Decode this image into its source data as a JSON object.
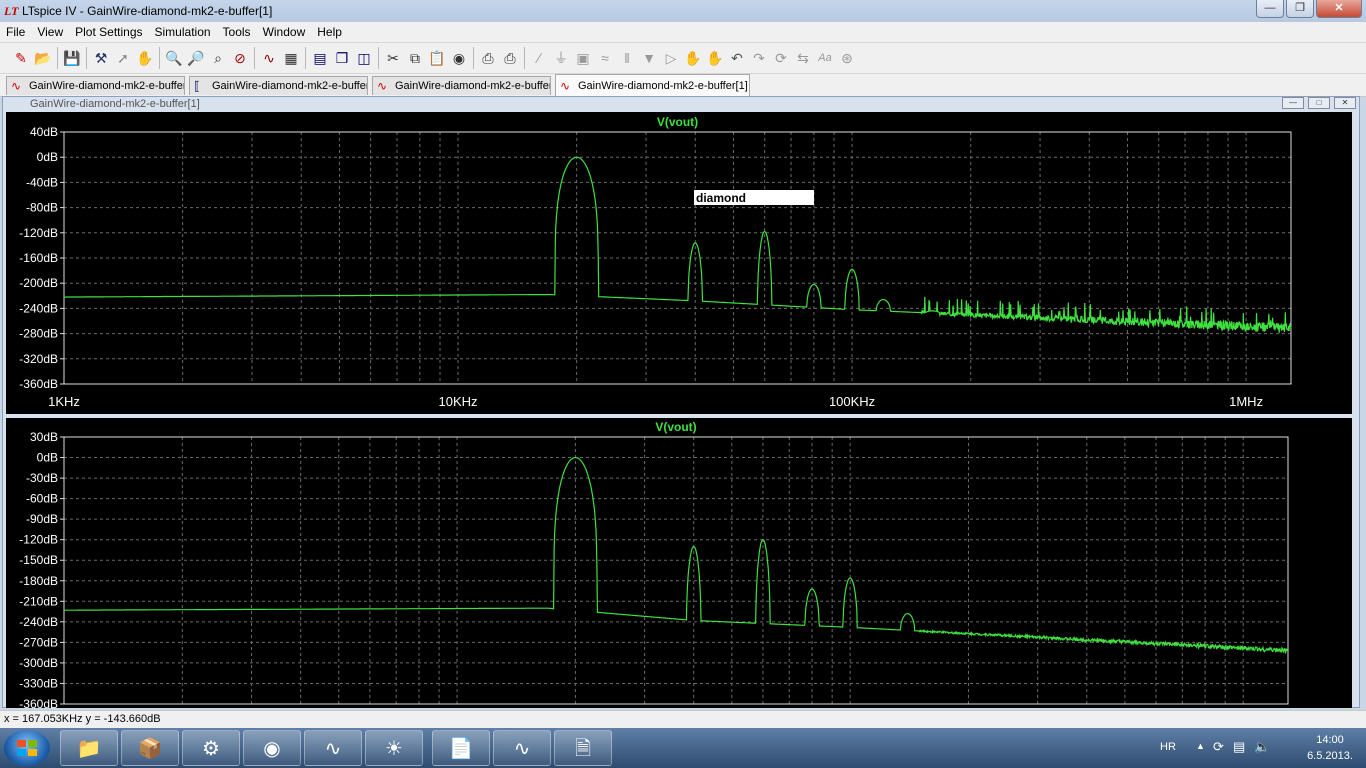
{
  "window": {
    "title": "LTspice IV - GainWire-diamond-mk2-e-buffer[1]",
    "app_icon": "LT"
  },
  "menu": [
    "File",
    "View",
    "Plot Settings",
    "Simulation",
    "Tools",
    "Window",
    "Help"
  ],
  "toolbar_icons": [
    "new-schematic-icon",
    "open-icon",
    "save-icon",
    "control-panel-icon",
    "run-icon",
    "halt-icon",
    "zoom-in-icon",
    "zoom-out-icon",
    "zoom-fit-icon",
    "zoom-cancel-icon",
    "autorange-icon",
    "mark-icon",
    "tile-horizontal-icon",
    "cascade-icon",
    "tile-vertical-icon",
    "cut-icon",
    "copy-icon",
    "paste-icon",
    "find-icon",
    "print-preview-icon",
    "print-icon",
    "wire-icon",
    "ground-icon",
    "label-icon",
    "resistor-icon",
    "capacitor-icon",
    "diode-icon",
    "component-icon",
    "move-icon",
    "drag-icon",
    "undo-icon",
    "redo-icon",
    "rotate-icon",
    "mirror-icon",
    "text-icon",
    "spice-directive-icon"
  ],
  "tabs": [
    {
      "label": "GainWire-diamond-mk2-e-buffer",
      "icon": "waveform-icon",
      "active": false
    },
    {
      "label": "GainWire-diamond-mk2-e-buffer",
      "icon": "schematic-icon",
      "active": false
    },
    {
      "label": "GainWire-diamond-mk2-e-buffer",
      "icon": "waveform-icon",
      "active": false
    },
    {
      "label": "GainWire-diamond-mk2-e-buffer[1]",
      "icon": "waveform-icon",
      "active": true
    }
  ],
  "mdi_child": {
    "title": "GainWire-diamond-mk2-e-buffer[1]"
  },
  "chart_data": [
    {
      "type": "line",
      "title": "V(vout)",
      "annotation": "diamond",
      "xscale": "log",
      "xlim": [
        1000,
        1300000
      ],
      "xticks": [
        "1KHz",
        "10KHz",
        "100KHz",
        "1MHz"
      ],
      "ylim": [
        -360,
        40
      ],
      "yticks": [
        "40dB",
        "0dB",
        "-40dB",
        "-80dB",
        "-120dB",
        "-160dB",
        "-200dB",
        "-240dB",
        "-280dB",
        "-320dB",
        "-360dB"
      ],
      "grid": true,
      "series": [
        {
          "name": "V(vout)",
          "color": "#3fe03f",
          "noise_floor": "rising",
          "peaks": [
            {
              "f": 20000,
              "db": 0
            },
            {
              "f": 40000,
              "db": -136
            },
            {
              "f": 60000,
              "db": -118
            },
            {
              "f": 80000,
              "db": -202
            },
            {
              "f": 100000,
              "db": -178
            },
            {
              "f": 120000,
              "db": -226
            },
            {
              "f": 160000,
              "db": -244
            }
          ],
          "floor_points": [
            [
              1000,
              -222
            ],
            [
              17000,
              -218
            ],
            [
              40000,
              -228
            ],
            [
              100000,
              -242
            ],
            [
              1300000,
              -272
            ]
          ]
        }
      ]
    },
    {
      "type": "line",
      "title": "V(vout)",
      "xscale": "log",
      "xlim": [
        1000,
        1300000
      ],
      "ylim": [
        -360,
        30
      ],
      "yticks": [
        "30dB",
        "0dB",
        "-30dB",
        "-60dB",
        "-90dB",
        "-120dB",
        "-150dB",
        "-180dB",
        "-210dB",
        "-240dB",
        "-270dB",
        "-300dB",
        "-330dB",
        "-360dB"
      ],
      "grid": true,
      "series": [
        {
          "name": "V(vout)",
          "color": "#3fe03f",
          "noise_floor": "falling",
          "peaks": [
            {
              "f": 20000,
              "db": 0
            },
            {
              "f": 40000,
              "db": -130
            },
            {
              "f": 60000,
              "db": -120
            },
            {
              "f": 80000,
              "db": -192
            },
            {
              "f": 100000,
              "db": -176
            },
            {
              "f": 140000,
              "db": -228
            }
          ],
          "floor_points": [
            [
              1000,
              -223
            ],
            [
              17000,
              -220
            ],
            [
              40000,
              -238
            ],
            [
              100000,
              -248
            ],
            [
              1300000,
              -282
            ]
          ]
        }
      ]
    }
  ],
  "status": {
    "cursor": "x = 167.053KHz    y = -143.660dB"
  },
  "taskbar": {
    "apps": [
      "explorer-icon",
      "archive-icon",
      "joystick-icon",
      "browser-red-icon",
      "oscilloscope-icon",
      "ie-icon",
      "folder-window-icon",
      "ltspice-icon",
      "document-icon"
    ],
    "lang": "HR",
    "time": "14:00",
    "date": "6.5.2013."
  }
}
